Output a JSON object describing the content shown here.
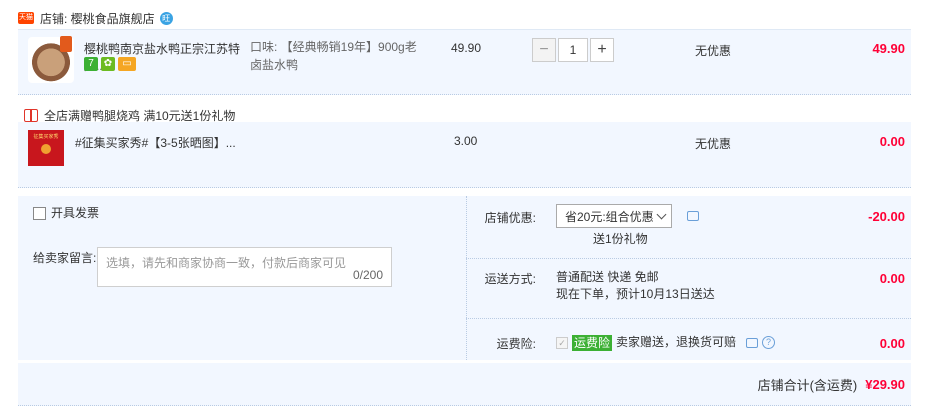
{
  "shop": {
    "tag": "天猫",
    "name": "店铺: 樱桃食品旗舰店",
    "ww": "旺"
  },
  "items": [
    {
      "title": "樱桃鸭南京盐水鸭正宗江苏特产...",
      "sku_line1": "口味: 【经典畅销19年】900g老",
      "sku_line2": "卤盐水鸭",
      "price": "49.90",
      "qty": "1",
      "promo": "无优惠",
      "subtotal": "49.90",
      "services": [
        "7",
        "✿",
        "▭"
      ]
    },
    {
      "title": "#征集买家秀#【3-5张晒图】...",
      "price": "3.00",
      "promo": "无优惠",
      "subtotal": "0.00",
      "thumb_text": "征集买家秀"
    }
  ],
  "gift_banner": "全店满赠鸭腿烧鸡   满10元送1份礼物",
  "invoice_label": "开具发票",
  "memo": {
    "label": "给卖家留言:",
    "placeholder": "选填，请先和商家协商一致，付款后商家可见",
    "count": "0/200"
  },
  "shop_discount": {
    "label": "店铺优惠:",
    "selected": "省20元:组合优惠",
    "note": "送1份礼物",
    "amount": "-20.00"
  },
  "shipping": {
    "label": "运送方式:",
    "line1": "普通配送 快递 免邮",
    "line2": "现在下单，预计10月13日送达",
    "amount": "0.00"
  },
  "insurance": {
    "label": "运费险:",
    "tag": "运费险",
    "text": "卖家赠送，退换货可赔",
    "amount": "0.00"
  },
  "total": {
    "label": "店铺合计(含运费)",
    "value": "¥29.90"
  }
}
